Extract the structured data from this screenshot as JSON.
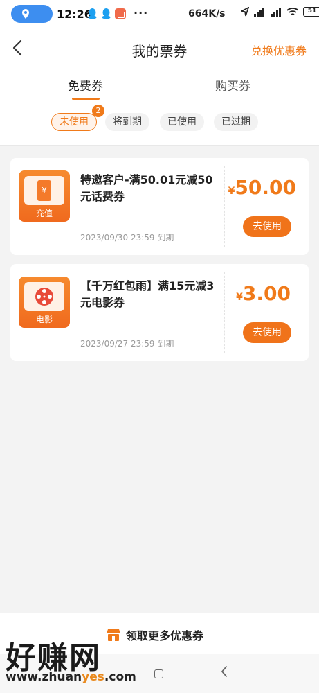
{
  "status_bar": {
    "time": "12:26",
    "net_speed": "664K/s",
    "battery": "51"
  },
  "header": {
    "title": "我的票券",
    "exchange_label": "兑换优惠券"
  },
  "tabs": {
    "free": "免费券",
    "buy": "购买券"
  },
  "filters": {
    "unused": "未使用",
    "unused_count": "2",
    "expiring": "将到期",
    "used": "已使用",
    "expired": "已过期"
  },
  "coupons": [
    {
      "title": "特邀客户-满50.01元减50元话费券",
      "icon_label": "充值",
      "icon_name": "phone-recharge-icon",
      "currency": "¥",
      "amount": "50.00",
      "expiry": "2023/09/30 23:59 到期",
      "button": "去使用"
    },
    {
      "title": "【千万红包雨】满15元减3元电影券",
      "icon_label": "电影",
      "icon_name": "film-reel-icon",
      "currency": "¥",
      "amount": "3.00",
      "expiry": "2023/09/27 23:59 到期",
      "button": "去使用"
    }
  ],
  "bottom": {
    "more_label": "领取更多优惠券"
  },
  "watermark": {
    "text": "好赚网",
    "url_a": "www.zhuan",
    "url_hl": "yes",
    "url_b": ".com"
  },
  "colors": {
    "accent": "#f07a1a",
    "location_pill": "#3d8ef0"
  }
}
